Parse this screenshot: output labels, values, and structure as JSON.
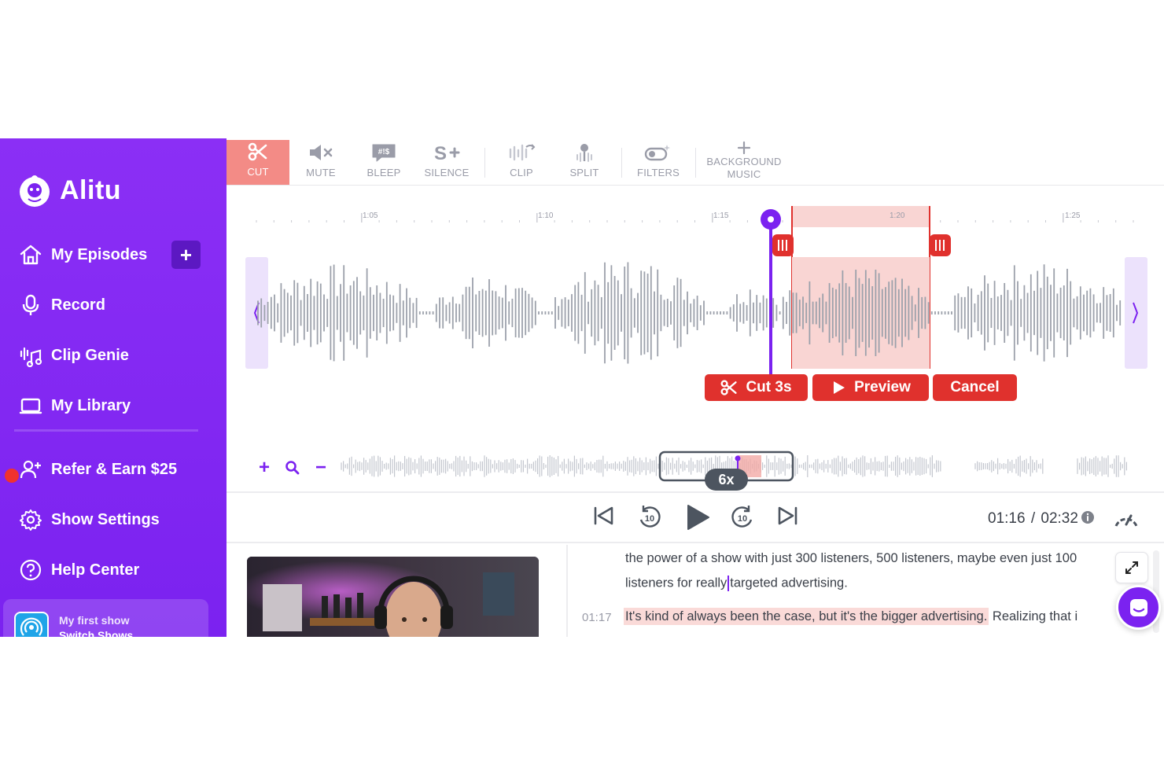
{
  "brand": {
    "name": "Alitu",
    "accent": "#7b22f0",
    "cut_color": "#e0312d"
  },
  "sidebar": {
    "items": [
      {
        "label": "My Episodes",
        "icon": "home-icon"
      },
      {
        "label": "Record",
        "icon": "microphone-icon"
      },
      {
        "label": "Clip Genie",
        "icon": "clip-genie-icon"
      },
      {
        "label": "My Library",
        "icon": "library-icon"
      },
      {
        "label": "Refer & Earn $25",
        "icon": "add-user-icon"
      },
      {
        "label": "Show Settings",
        "icon": "gear-icon"
      },
      {
        "label": "Help Center",
        "icon": "help-icon"
      }
    ],
    "add_label": "+",
    "show": {
      "name": "My first show",
      "switch_label": "Switch Shows"
    }
  },
  "toolbar": {
    "tools": [
      {
        "label": "CUT",
        "icon": "scissors-icon",
        "active": true
      },
      {
        "label": "MUTE",
        "icon": "mute-icon"
      },
      {
        "label": "BLEEP",
        "icon": "bleep-icon"
      },
      {
        "label": "SILENCE",
        "icon": "silence-icon"
      },
      {
        "label": "CLIP",
        "icon": "clip-icon"
      },
      {
        "label": "SPLIT",
        "icon": "split-icon"
      },
      {
        "label": "FILTERS",
        "icon": "filters-icon"
      },
      {
        "label": "BACKGROUND",
        "label2": "MUSIC",
        "icon": "plus-icon"
      }
    ]
  },
  "timeline": {
    "ruler": [
      "1:05",
      "1:10",
      "1:15",
      "1:20",
      "1:25"
    ],
    "actions": {
      "cut": "Cut 3s",
      "preview": "Preview",
      "cancel": "Cancel"
    },
    "zoom": {
      "in": "+",
      "out": "−"
    },
    "speed": "6x"
  },
  "transport": {
    "current": "01:16",
    "total": "02:32"
  },
  "transcript": {
    "line1": "the power of a show with just 300 listeners, 500 listeners, maybe even just 100",
    "line2a": "listeners for really",
    "line2b": "targeted advertising.",
    "time2": "01:17",
    "line3_highlight": "It's kind of always been the case, but it's the bigger advertising.",
    "line3_rest": " Realizing that i"
  }
}
